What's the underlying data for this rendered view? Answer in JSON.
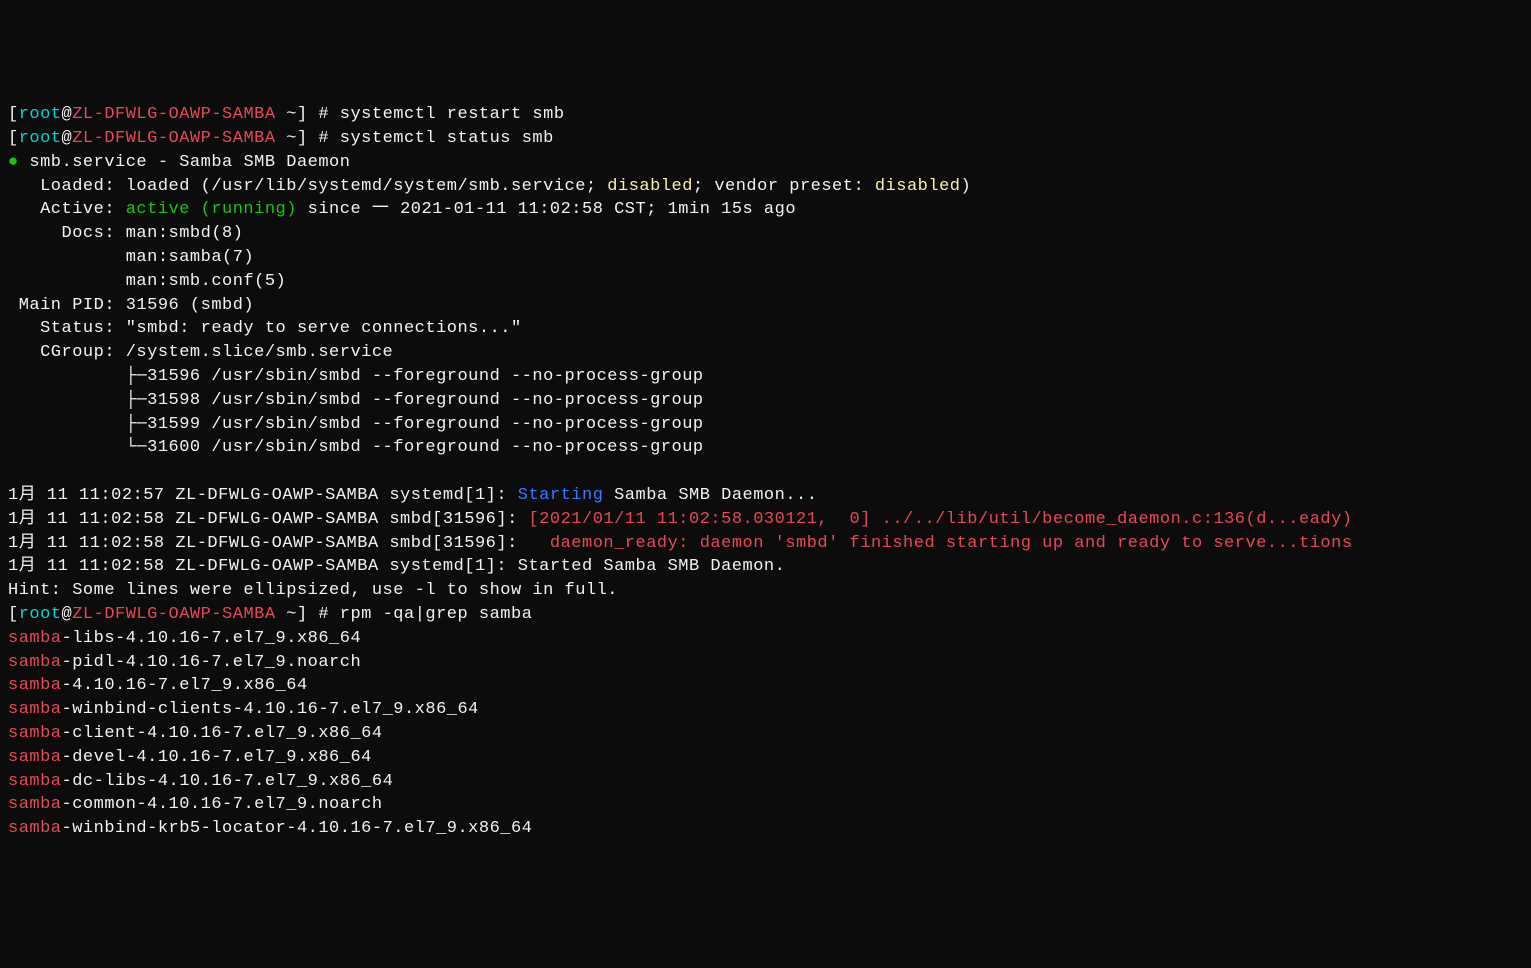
{
  "prompt": {
    "user_open": "[",
    "user": "root",
    "at": "@",
    "host": "ZL-DFWLG-OAWP-SAMBA",
    "path": " ~",
    "close": "]",
    "hash": " # "
  },
  "commands": {
    "restart": "systemctl restart smb",
    "status": "systemctl status smb",
    "rpm": "rpm -qa|grep samba"
  },
  "service": {
    "bullet": "●",
    "name": " smb.service - Samba SMB Daemon",
    "loaded_label": "   Loaded: ",
    "loaded_value": "loaded (/usr/lib/systemd/system/smb.service; ",
    "loaded_disabled1": "disabled",
    "loaded_mid": "; vendor preset: ",
    "loaded_disabled2": "disabled",
    "loaded_end": ")",
    "active_label": "   Active: ",
    "active_state": "active (running)",
    "active_since": " since 一 2021-01-11 11:02:58 CST; 1min 15s ago",
    "docs_label": "     Docs: ",
    "docs1": "man:smbd(8)",
    "docs2": "           man:samba(7)",
    "docs3": "           man:smb.conf(5)",
    "mainpid": " Main PID: 31596 (smbd)",
    "status_label": "   Status: ",
    "status_value": "\"smbd: ready to serve connections...\"",
    "cgroup_label": "   CGroup: ",
    "cgroup_value": "/system.slice/smb.service",
    "proc1": "           ├─31596 /usr/sbin/smbd --foreground --no-process-group",
    "proc2": "           ├─31598 /usr/sbin/smbd --foreground --no-process-group",
    "proc3": "           ├─31599 /usr/sbin/smbd --foreground --no-process-group",
    "proc4": "           └─31600 /usr/sbin/smbd --foreground --no-process-group"
  },
  "log": {
    "l1_pre": "1月 11 11:02:57 ZL-DFWLG-OAWP-SAMBA systemd[1]: ",
    "l1_blue": "Starting",
    "l1_post": " Samba SMB Daemon...",
    "l2_pre": "1月 11 11:02:58 ZL-DFWLG-OAWP-SAMBA smbd[31596]: ",
    "l2_red": "[2021/01/11 11:02:58.030121,  0] ../../lib/util/become_daemon.c:136(d...eady)",
    "l3_pre": "1月 11 11:02:58 ZL-DFWLG-OAWP-SAMBA smbd[31596]:   ",
    "l3_red": "daemon_ready: daemon 'smbd' finished starting up and ready to serve...tions",
    "l4": "1月 11 11:02:58 ZL-DFWLG-OAWP-SAMBA systemd[1]: Started Samba SMB Daemon.",
    "hint": "Hint: Some lines were ellipsized, use -l to show in full."
  },
  "rpm_out": [
    {
      "pkg": "samba",
      "rest": "-libs-4.10.16-7.el7_9.x86_64"
    },
    {
      "pkg": "samba",
      "rest": "-pidl-4.10.16-7.el7_9.noarch"
    },
    {
      "pkg": "samba",
      "rest": "-4.10.16-7.el7_9.x86_64"
    },
    {
      "pkg": "samba",
      "rest": "-winbind-clients-4.10.16-7.el7_9.x86_64"
    },
    {
      "pkg": "samba",
      "rest": "-client-4.10.16-7.el7_9.x86_64"
    },
    {
      "pkg": "samba",
      "rest": "-devel-4.10.16-7.el7_9.x86_64"
    },
    {
      "pkg": "samba",
      "rest": "-dc-libs-4.10.16-7.el7_9.x86_64"
    },
    {
      "pkg": "samba",
      "rest": "-common-4.10.16-7.el7_9.noarch"
    },
    {
      "pkg": "samba",
      "rest": "-winbind-krb5-locator-4.10.16-7.el7_9.x86_64"
    }
  ]
}
